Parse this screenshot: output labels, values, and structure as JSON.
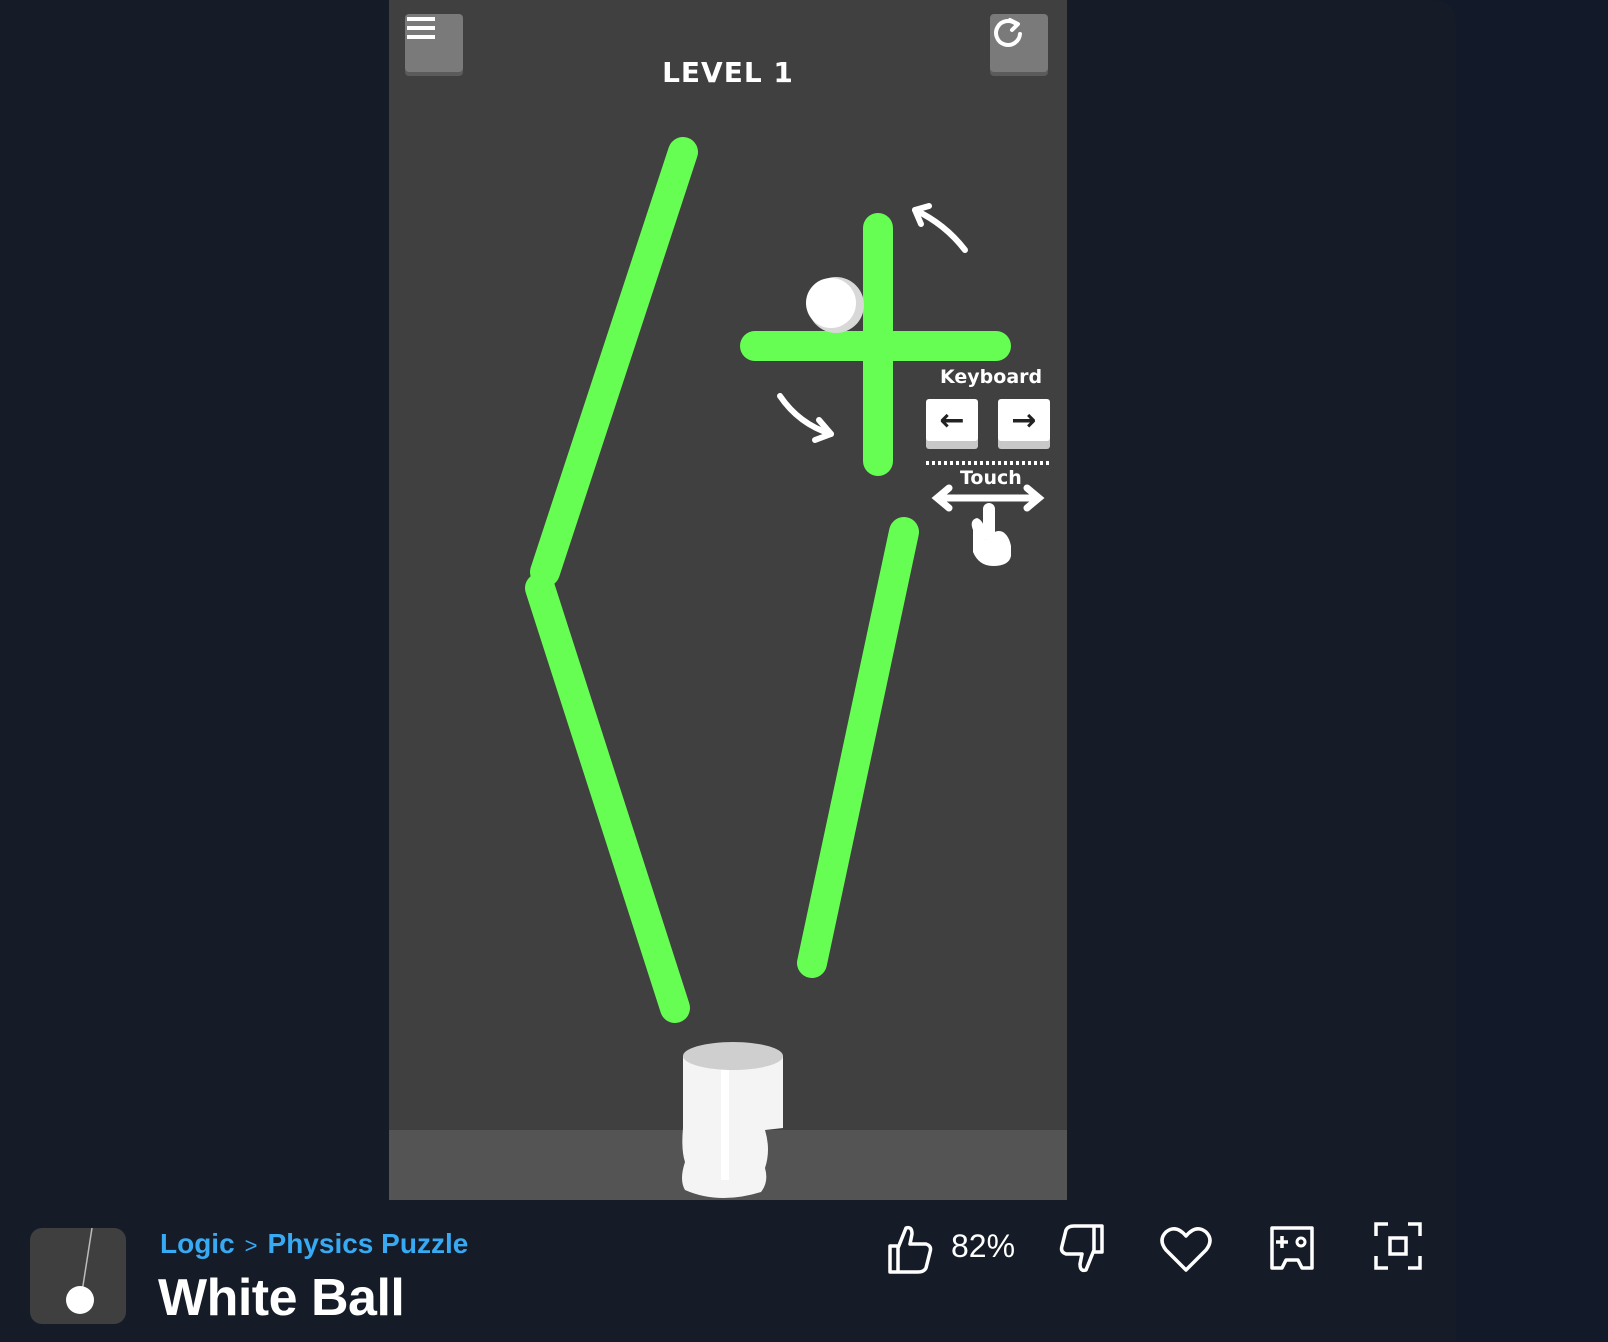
{
  "game": {
    "level_label": "LEVEL 1",
    "hints": {
      "keyboard_label": "Keyboard",
      "touch_label": "Touch",
      "left_key": "←",
      "right_key": "→"
    },
    "colors": {
      "bar": "#66fe52",
      "background": "#404040",
      "floor": "#545454",
      "ball": "#ffffff"
    }
  },
  "info_bar": {
    "breadcrumb": {
      "category": "Logic",
      "separator": ">",
      "subcategory": "Physics Puzzle"
    },
    "title": "White Ball",
    "rating": "82%",
    "icons": [
      "thumbs-up-icon",
      "thumbs-down-icon",
      "heart-icon",
      "gamepad-add-icon",
      "fullscreen-icon"
    ],
    "accent_color": "#38aaf3"
  }
}
